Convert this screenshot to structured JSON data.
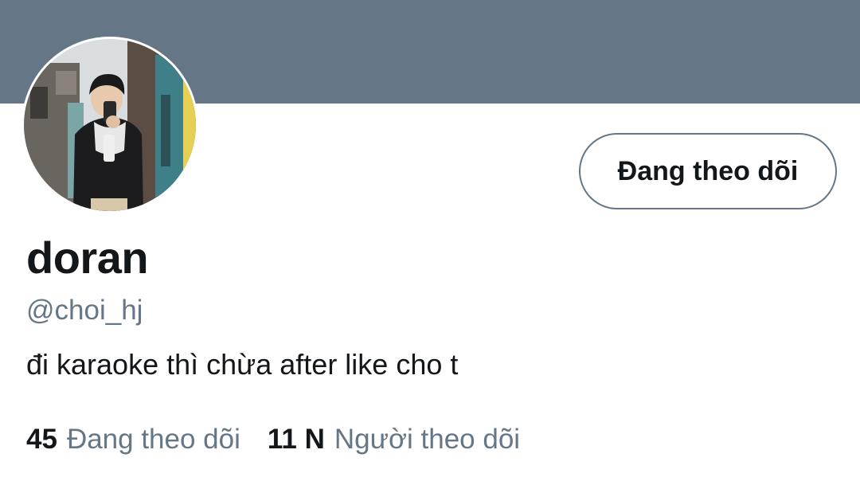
{
  "profile": {
    "display_name": "doran",
    "handle": "@choi_hj",
    "bio": "đi karaoke thì chừa after like cho t",
    "follow_button_label": "Đang theo dõi",
    "avatar_icon": "profile-photo"
  },
  "stats": {
    "following_count": "45",
    "following_label": "Đang theo dõi",
    "followers_count": "11 N",
    "followers_label": "Người theo dõi"
  },
  "colors": {
    "banner": "#657786",
    "secondary_text": "#657786",
    "primary_text": "#14171a"
  }
}
